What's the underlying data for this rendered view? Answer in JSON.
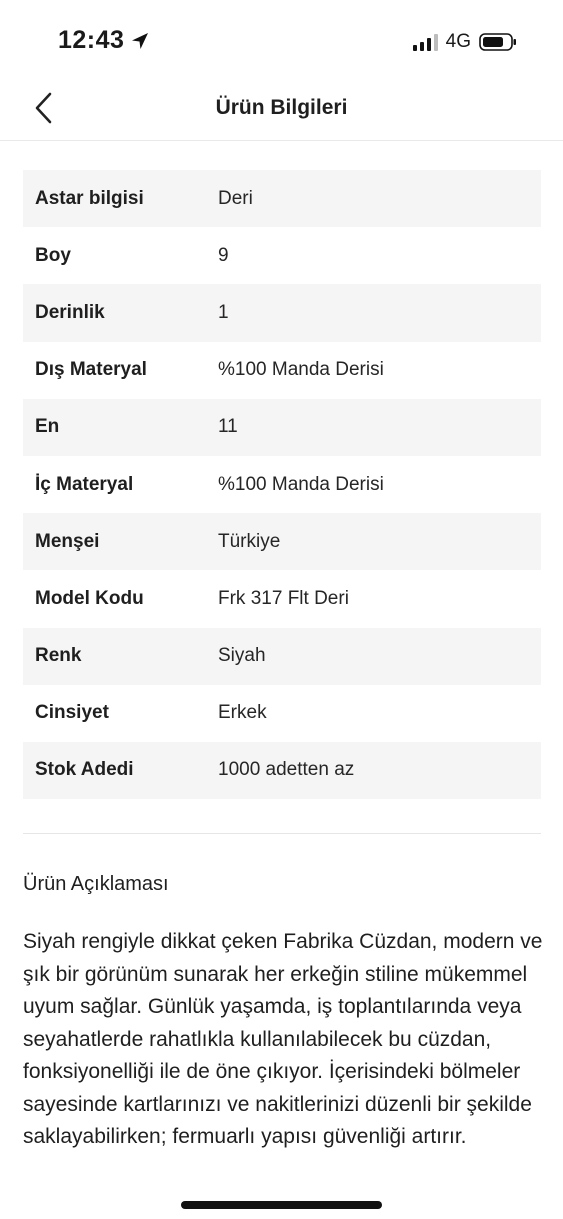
{
  "status_bar": {
    "time": "12:43",
    "network": "4G",
    "icons": [
      "location-arrow-icon",
      "signal-icon",
      "battery-icon"
    ]
  },
  "header": {
    "title": "Ürün Bilgileri",
    "back_icon": "chevron-left-icon"
  },
  "specs": [
    {
      "label": "Astar bilgisi",
      "value": "Deri"
    },
    {
      "label": "Boy",
      "value": "9"
    },
    {
      "label": "Derinlik",
      "value": "1"
    },
    {
      "label": "Dış Materyal",
      "value": "%100 Manda Derisi"
    },
    {
      "label": "En",
      "value": "11"
    },
    {
      "label": "İç Materyal",
      "value": "%100 Manda Derisi"
    },
    {
      "label": "Menşei",
      "value": "Türkiye"
    },
    {
      "label": "Model Kodu",
      "value": "Frk 317 Flt Deri"
    },
    {
      "label": "Renk",
      "value": "Siyah"
    },
    {
      "label": "Cinsiyet",
      "value": "Erkek"
    },
    {
      "label": "Stok Adedi",
      "value": "1000 adetten az"
    }
  ],
  "description": {
    "title": "Ürün Açıklaması",
    "text": "Siyah rengiyle dikkat çeken Fabrika Cüzdan, modern ve şık bir görünüm sunarak her erkeğin stiline mükemmel uyum sağlar. Günlük yaşamda, iş toplantılarında veya seyahatlerde rahatlıkla kullanılabilecek bu cüzdan, fonksiyonelliği ile de öne çıkıyor. İçerisindeki bölmeler sayesinde kartlarınızı ve nakitlerinizi düzenli bir şekilde saklayabilirken; fermuarlı yapısı güvenliği artırır."
  },
  "colors": {
    "row_shade": "#f6f5f5",
    "text": "#1f1f1f",
    "divider": "#e6e6e6"
  }
}
